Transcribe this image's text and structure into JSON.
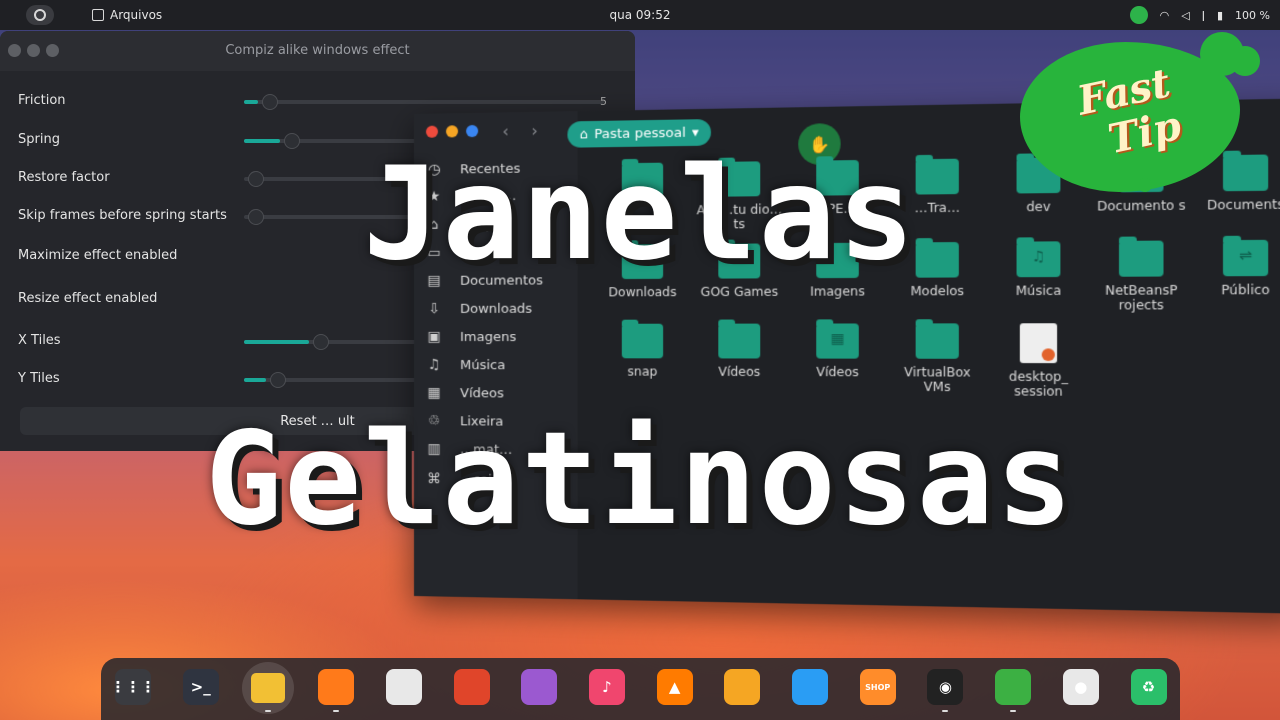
{
  "topbar": {
    "app_name": "Arquivos",
    "clock": "qua 09:52",
    "battery": "100 %"
  },
  "settings": {
    "title": "Compiz alike windows effect",
    "rows": [
      {
        "label": "Friction",
        "value_text": "5",
        "slider": 0.04
      },
      {
        "label": "Spring",
        "value_text": "",
        "slider": 0.1
      },
      {
        "label": "Restore factor",
        "value_text": "",
        "slider": 0.0
      },
      {
        "label": "Skip frames before spring starts",
        "value_text": "",
        "slider": 0.0
      },
      {
        "label": "Maximize effect enabled",
        "value_text": "",
        "slider": null
      },
      {
        "label": "Resize effect enabled",
        "value_text": "",
        "slider": null
      },
      {
        "label": "X Tiles",
        "value_text": "",
        "slider": 0.18
      },
      {
        "label": "Y Tiles",
        "value_text": "",
        "slider": 0.06
      }
    ],
    "reset_label": "Reset … ult"
  },
  "files": {
    "path_label": "Pasta pessoal",
    "sidebar": [
      {
        "label": "Recentes",
        "icon": "clock-icon"
      },
      {
        "label": "…vorit…",
        "icon": "star-icon"
      },
      {
        "label": "…a p…",
        "icon": "home-icon"
      },
      {
        "label": "De…lh…",
        "icon": "desktop-icon"
      },
      {
        "label": "Documentos",
        "icon": "document-icon"
      },
      {
        "label": "Downloads",
        "icon": "download-icon"
      },
      {
        "label": "Imagens",
        "icon": "image-icon"
      },
      {
        "label": "Música",
        "icon": "music-icon"
      },
      {
        "label": "Vídeos",
        "icon": "video-icon"
      },
      {
        "label": "Lixeira",
        "icon": "trash-icon"
      },
      {
        "label": "…mat…",
        "icon": "drive-icon"
      },
      {
        "label": "…cais",
        "icon": "network-icon"
      }
    ],
    "grid": [
      {
        "label": "",
        "sym": ""
      },
      {
        "label": "Ano…tu dio…ts",
        "sym": ""
      },
      {
        "label": "APE…",
        "sym": ""
      },
      {
        "label": "…Tra…",
        "sym": ""
      },
      {
        "label": "dev",
        "sym": ""
      },
      {
        "label": "Documento s",
        "sym": "⌂"
      },
      {
        "label": "Documents",
        "sym": ""
      },
      {
        "label": "Downloads",
        "sym": ""
      },
      {
        "label": "GOG Games",
        "sym": ""
      },
      {
        "label": "Imagens",
        "sym": ""
      },
      {
        "label": "Modelos",
        "sym": ""
      },
      {
        "label": "Música",
        "sym": "♫"
      },
      {
        "label": "NetBeansP rojects",
        "sym": ""
      },
      {
        "label": "Público",
        "sym": "⇌"
      },
      {
        "label": "snap",
        "sym": ""
      },
      {
        "label": "Vídeos",
        "sym": ""
      },
      {
        "label": "Vídeos",
        "sym": "▦"
      },
      {
        "label": "VirtualBox VMs",
        "sym": ""
      },
      {
        "label": "desktop_ session",
        "sym": ""
      }
    ]
  },
  "overlay": {
    "line1": "Janelas",
    "line2": "Gelatinosas"
  },
  "badge": {
    "line1": "Fast",
    "line2": "Tip"
  },
  "dock": {
    "items": [
      {
        "name": "app-grid-icon",
        "glyph": "⋮⋮⋮",
        "color": "#3a3b40",
        "running": false
      },
      {
        "name": "terminal-icon",
        "glyph": ">_",
        "color": "#2f3440",
        "running": false
      },
      {
        "name": "files-icon",
        "glyph": "",
        "color": "#f2c034",
        "running": true
      },
      {
        "name": "firefox-icon",
        "glyph": "",
        "color": "#ff7a1a",
        "running": true
      },
      {
        "name": "chrome-icon",
        "glyph": "",
        "color": "#e8e8e8",
        "running": false
      },
      {
        "name": "office-icon",
        "glyph": "",
        "color": "#e0452a",
        "running": false
      },
      {
        "name": "crop-icon",
        "glyph": "",
        "color": "#9b59d0",
        "running": false
      },
      {
        "name": "music-app-icon",
        "glyph": "♪",
        "color": "#f0466e",
        "running": false
      },
      {
        "name": "vlc-icon",
        "glyph": "▲",
        "color": "#ff7b00",
        "running": false
      },
      {
        "name": "paint-icon",
        "glyph": "",
        "color": "#f5a623",
        "running": false
      },
      {
        "name": "box-icon",
        "glyph": "",
        "color": "#2a9df4",
        "running": false
      },
      {
        "name": "shop-icon",
        "glyph": "SHOP",
        "color": "#ff8c2a",
        "running": false
      },
      {
        "name": "obs-icon",
        "glyph": "◉",
        "color": "#222222",
        "running": true
      },
      {
        "name": "extension-icon",
        "glyph": "",
        "color": "#3cb043",
        "running": true
      },
      {
        "name": "recorder-icon",
        "glyph": "●",
        "color": "#e8e8e8",
        "running": false
      },
      {
        "name": "trash-dock-icon",
        "glyph": "♻",
        "color": "#2bbf6a",
        "running": false
      }
    ]
  }
}
